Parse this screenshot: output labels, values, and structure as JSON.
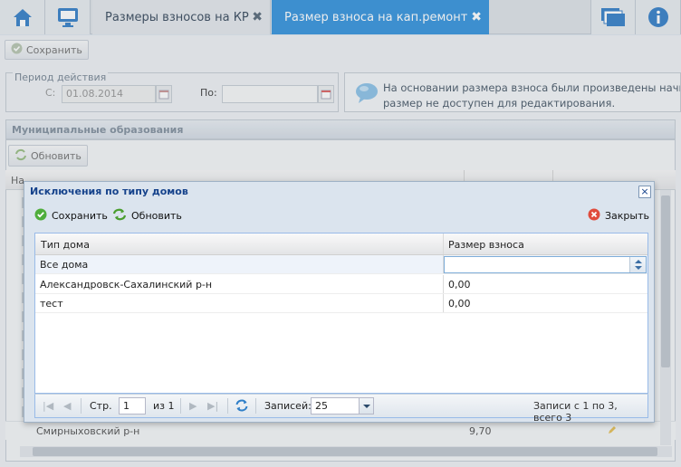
{
  "tabs": [
    {
      "label": "Размеры взносов на КР",
      "close": "✖"
    },
    {
      "label": "Размер взноса на кап.ремонт",
      "close": "✖"
    }
  ],
  "toolbar": {
    "save_label": "Сохранить"
  },
  "period": {
    "legend": "Период действия",
    "from_label": "С:",
    "from_value": "01.08.2014",
    "to_label": "По:",
    "to_value": ""
  },
  "info_text": "На основании размера взноса были произведены начисления размер не доступен для редактирования.",
  "info_line1": "На основании размера взноса были произведены начисл",
  "info_line2": "размер не доступен для редактирования.",
  "muni": {
    "title": "Муниципальные образования",
    "refresh_label": "Обновить",
    "header_partial": "На",
    "bottom_row_name": "Смирныховский р-н",
    "bottom_row_value": "9,70"
  },
  "modal": {
    "title": "Исключения по типу домов",
    "close_symbol": "×",
    "save_label": "Сохранить",
    "refresh_label": "Обновить",
    "close_label": "Закрыть",
    "columns": [
      "Тип дома",
      "Размер взноса"
    ],
    "rows": [
      {
        "type": "Все дома",
        "value": ""
      },
      {
        "type": "Александровск-Сахалинский р-н",
        "value": "0,00"
      },
      {
        "type": "тест",
        "value": "0,00"
      }
    ],
    "pager": {
      "page_label": "Стр.",
      "page_value": "1",
      "of_label": "из 1",
      "records_label": "Записей:",
      "records_value": "25",
      "summary": "Записи с 1 по 3, всего 3"
    }
  },
  "colors": {
    "active_tab": "#3a96dd",
    "modal_title": "#15428b"
  }
}
